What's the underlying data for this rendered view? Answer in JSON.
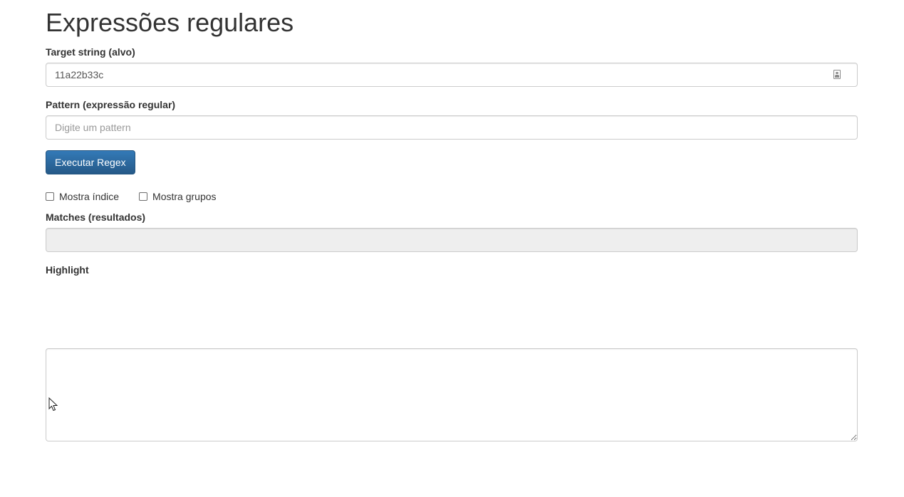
{
  "page": {
    "title": "Expressões regulares"
  },
  "target": {
    "label": "Target string (alvo)",
    "value": "11a22b33c",
    "icon": "password-manager-icon"
  },
  "pattern": {
    "label": "Pattern (expressão regular)",
    "value": "",
    "placeholder": "Digite um pattern"
  },
  "execute_button": {
    "label": "Executar Regex",
    "color": "#337ab7"
  },
  "options": {
    "show_index_label": "Mostra índice",
    "show_index_checked": false,
    "show_groups_label": "Mostra grupos",
    "show_groups_checked": false
  },
  "matches": {
    "label": "Matches (resultados)",
    "value": ""
  },
  "highlight": {
    "label": "Highlight",
    "value": ""
  }
}
